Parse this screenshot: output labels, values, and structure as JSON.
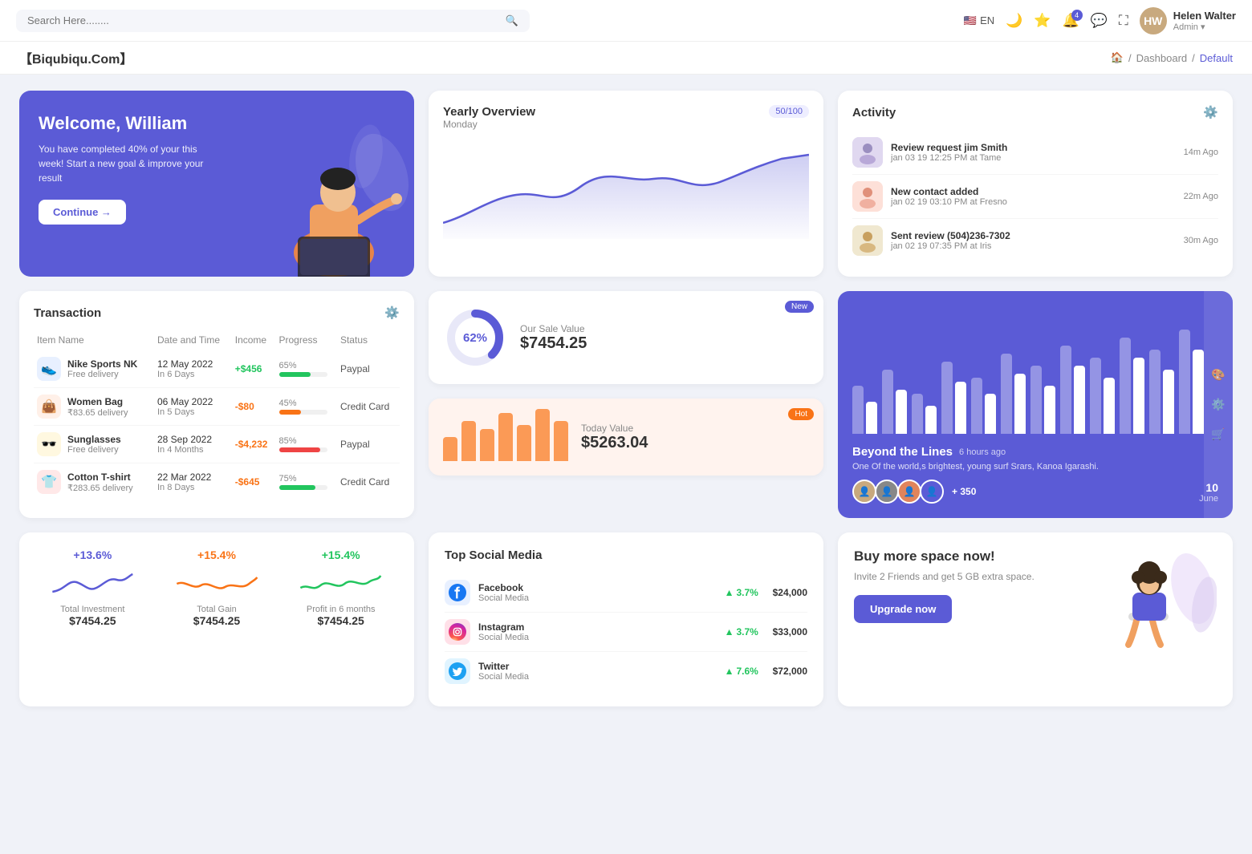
{
  "topnav": {
    "search_placeholder": "Search Here........",
    "lang": "EN",
    "notification_count": "4",
    "user": {
      "name": "Helen Walter",
      "role": "Admin",
      "initials": "HW"
    }
  },
  "breadcrumb": {
    "brand": "【Biqubiqu.Com】",
    "home_icon": "🏠",
    "separator": "/",
    "dashboard": "Dashboard",
    "current": "Default"
  },
  "welcome": {
    "title": "Welcome, William",
    "subtitle": "You have completed 40% of your this week! Start a new goal & improve your result",
    "button": "Continue →"
  },
  "yearly": {
    "title": "Yearly Overview",
    "subtitle": "Monday",
    "badge": "50/100"
  },
  "activity": {
    "title": "Activity",
    "items": [
      {
        "title": "Review request jim Smith",
        "sub": "jan 03 19 12:25 PM at Tame",
        "time": "14m Ago",
        "color": "#e0d8f0"
      },
      {
        "title": "New contact added",
        "sub": "jan 02 19 03:10 PM at Fresno",
        "time": "22m Ago",
        "color": "#fde0d8"
      },
      {
        "title": "Sent review (504)236-7302",
        "sub": "jan 02 19 07:35 PM at Iris",
        "time": "30m Ago",
        "color": "#f0e8d0"
      }
    ]
  },
  "transaction": {
    "title": "Transaction",
    "headers": [
      "Item Name",
      "Date and Time",
      "Income",
      "Progress",
      "Status"
    ],
    "rows": [
      {
        "name": "Nike Sports NK",
        "sub": "Free delivery",
        "date": "12 May 2022",
        "date_sub": "In 6 Days",
        "income": "+$456",
        "income_type": "pos",
        "progress": 65,
        "prog_color": "#22c55e",
        "status": "Paypal",
        "icon": "👟",
        "icon_bg": "#e8f0ff"
      },
      {
        "name": "Women Bag",
        "sub": "₹83.65 delivery",
        "date": "06 May 2022",
        "date_sub": "In 5 Days",
        "income": "-$80",
        "income_type": "neg",
        "progress": 45,
        "prog_color": "#f97316",
        "status": "Credit Card",
        "icon": "👜",
        "icon_bg": "#fff0e8"
      },
      {
        "name": "Sunglasses",
        "sub": "Free delivery",
        "date": "28 Sep 2022",
        "date_sub": "In 4 Months",
        "income": "-$4,232",
        "income_type": "neg",
        "progress": 85,
        "prog_color": "#ef4444",
        "status": "Paypal",
        "icon": "🕶️",
        "icon_bg": "#fff8e0"
      },
      {
        "name": "Cotton T-shirt",
        "sub": "₹283.65 delivery",
        "date": "22 Mar 2022",
        "date_sub": "In 8 Days",
        "income": "-$645",
        "income_type": "neg",
        "progress": 75,
        "prog_color": "#22c55e",
        "status": "Credit Card",
        "icon": "👕",
        "icon_bg": "#ffe8e8"
      }
    ]
  },
  "sale_value": {
    "title": "Our Sale Value",
    "amount": "$7454.25",
    "percent": "62%",
    "badge": "New"
  },
  "today_value": {
    "title": "Today Value",
    "amount": "$5263.04",
    "badge": "Hot",
    "bars": [
      30,
      50,
      40,
      65,
      55,
      70,
      45
    ]
  },
  "beyond": {
    "title": "Beyond the Lines",
    "time": "6 hours ago",
    "desc": "One Of the world,s brightest, young surf Srars, Kanoa Igarashi.",
    "plus": "+ 350",
    "date": "10",
    "month": "June"
  },
  "stats": [
    {
      "pct": "+13.6%",
      "color": "blue",
      "label": "Total Investment",
      "value": "$7454.25"
    },
    {
      "pct": "+15.4%",
      "color": "orange",
      "label": "Total Gain",
      "value": "$7454.25"
    },
    {
      "pct": "+15.4%",
      "color": "green",
      "label": "Profit in 6 months",
      "value": "$7454.25"
    }
  ],
  "social_media": {
    "title": "Top Social Media",
    "items": [
      {
        "name": "Facebook",
        "sub": "Social Media",
        "pct": "3.7%",
        "amount": "$24,000",
        "icon": "f",
        "icon_bg": "#1877f2",
        "icon_color": "#fff"
      },
      {
        "name": "Instagram",
        "sub": "Social Media",
        "pct": "3.7%",
        "amount": "$33,000",
        "icon": "📷",
        "icon_bg": "#e1306c",
        "icon_color": "#fff"
      },
      {
        "name": "Twitter",
        "sub": "Social Media",
        "pct": "7.6%",
        "amount": "$72,000",
        "icon": "t",
        "icon_bg": "#1da1f2",
        "icon_color": "#fff"
      }
    ]
  },
  "promo": {
    "title": "Buy more space now!",
    "desc": "Invite 2 Friends and get 5 GB extra space.",
    "button": "Upgrade now"
  },
  "bar_chart": {
    "bars": [
      {
        "light": 60,
        "white": 40
      },
      {
        "light": 80,
        "white": 55
      },
      {
        "light": 50,
        "white": 35
      },
      {
        "light": 90,
        "white": 65
      },
      {
        "light": 70,
        "white": 50
      },
      {
        "light": 100,
        "white": 75
      },
      {
        "light": 85,
        "white": 60
      },
      {
        "light": 110,
        "white": 85
      },
      {
        "light": 95,
        "white": 70
      },
      {
        "light": 120,
        "white": 95
      },
      {
        "light": 105,
        "white": 80
      },
      {
        "light": 130,
        "white": 105
      }
    ]
  }
}
